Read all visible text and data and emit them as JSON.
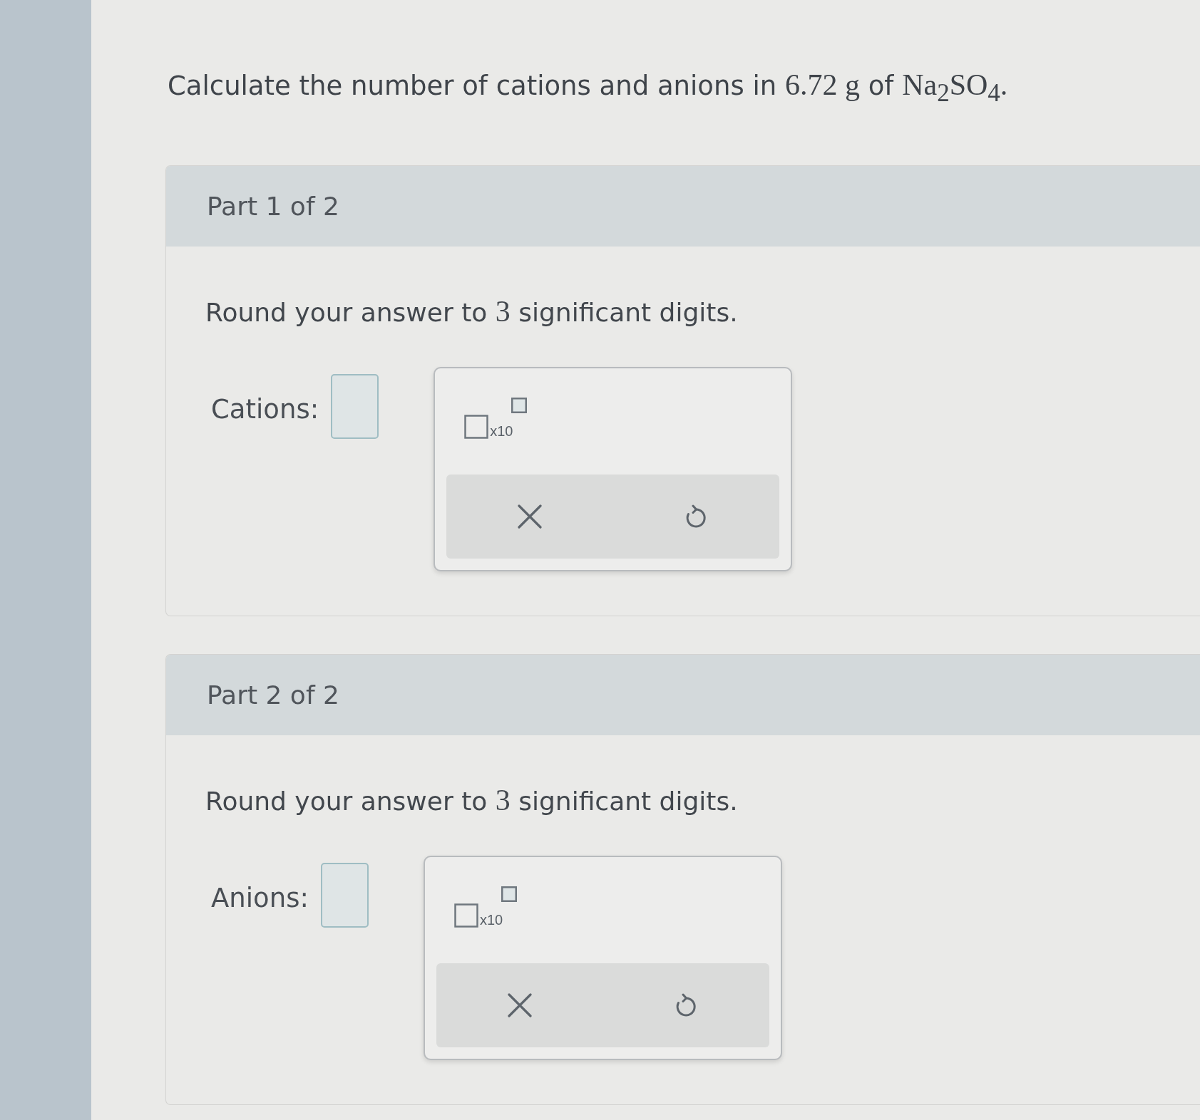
{
  "question": [
    {
      "kind": "text",
      "text": "Calculate the number of cations and anions in "
    },
    {
      "kind": "math",
      "text": "6.72 g"
    },
    {
      "kind": "text",
      "text": " of "
    },
    {
      "kind": "math",
      "text": "Na$_{2}$SO$_{4}$."
    }
  ],
  "parts": [
    {
      "title": "Part 1 of 2",
      "instruction": [
        {
          "kind": "text",
          "text": "Round your answer to "
        },
        {
          "kind": "math",
          "text": "3"
        },
        {
          "kind": "text",
          "text": " significant digits."
        }
      ],
      "answer_label": "Cations:",
      "palette": {
        "multiplier": "x10"
      }
    },
    {
      "title": "Part 2 of 2",
      "instruction": [
        {
          "kind": "text",
          "text": "Round your answer to "
        },
        {
          "kind": "math",
          "text": "3"
        },
        {
          "kind": "text",
          "text": " significant digits."
        }
      ],
      "answer_label": "Anions:",
      "palette": {
        "multiplier": "x10"
      }
    }
  ]
}
